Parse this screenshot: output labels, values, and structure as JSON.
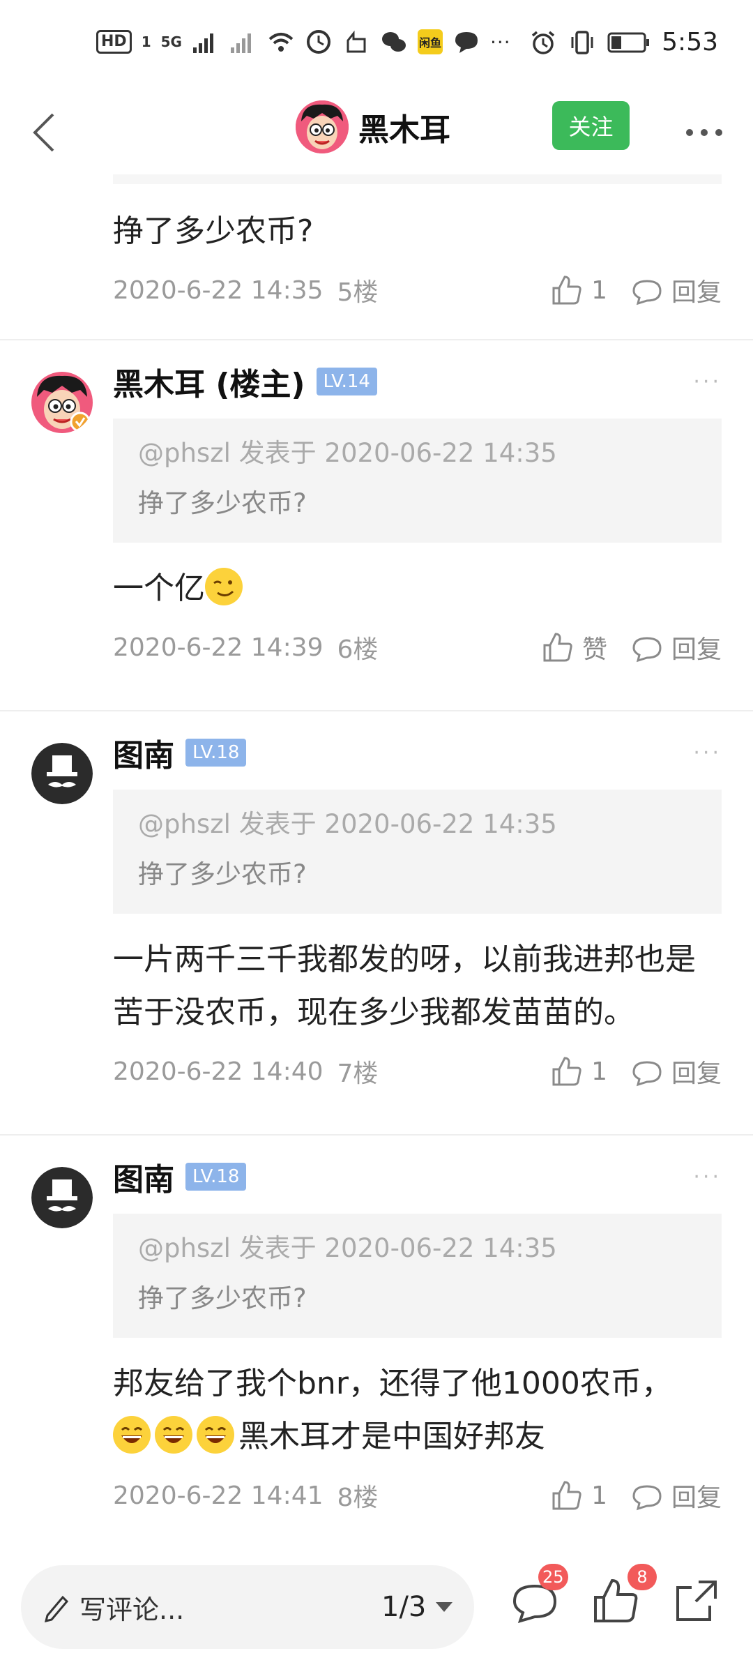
{
  "status_bar": {
    "hd": "HD",
    "sim_slot": "1",
    "signal_type": "5G",
    "time": "5:53",
    "app_tile": "闲鱼",
    "icons": [
      "wifi-icon",
      "clock-icon",
      "hand-icon",
      "wechat-icon",
      "chat-icon",
      "alarm-icon",
      "vibrate-icon",
      "battery-icon"
    ],
    "more": "···"
  },
  "nav": {
    "title": "黑木耳",
    "follow_label": "关注"
  },
  "comments": [
    {
      "partial": true,
      "text": "挣了多少农币?",
      "time": "2020-6-22 14:35",
      "floor": "5楼",
      "likes": "1",
      "reply_label": "回复"
    },
    {
      "name": "黑木耳 (楼主)",
      "level": "LV.14",
      "avatar": "cartoon",
      "quote_meta": "@phszl 发表于 2020-06-22 14:35",
      "quote_text": "挣了多少农币?",
      "text": "一个亿",
      "emoji_count": 1,
      "time": "2020-6-22 14:39",
      "floor": "6楼",
      "likes": "赞",
      "reply_label": "回复"
    },
    {
      "name": "图南",
      "level": "LV.18",
      "avatar": "tophat",
      "quote_meta": "@phszl 发表于 2020-06-22 14:35",
      "quote_text": "挣了多少农币?",
      "text": "一片两千三千我都发的呀，以前我进邦也是苦于没农币，现在多少我都发苗苗的。",
      "time": "2020-6-22 14:40",
      "floor": "7楼",
      "likes": "1",
      "reply_label": "回复"
    },
    {
      "name": "图南",
      "level": "LV.18",
      "avatar": "tophat",
      "quote_meta": "@phszl 发表于 2020-06-22 14:35",
      "quote_text": "挣了多少农币?",
      "text_line1": "邦友给了我个bnr，还得了他1000农币，",
      "text_line2": "黑木耳才是中国好邦友",
      "emoji_count": 3,
      "time": "2020-6-22 14:41",
      "floor": "8楼",
      "likes": "1",
      "reply_label": "回复"
    }
  ],
  "bottom_bar": {
    "compose_placeholder": "写评论...",
    "page_indicator": "1/3",
    "comment_count": "25",
    "like_count": "8"
  },
  "colors": {
    "follow_green": "#3cba5a",
    "level_blue": "#8db4ea",
    "badge_red": "#f25a5a"
  }
}
